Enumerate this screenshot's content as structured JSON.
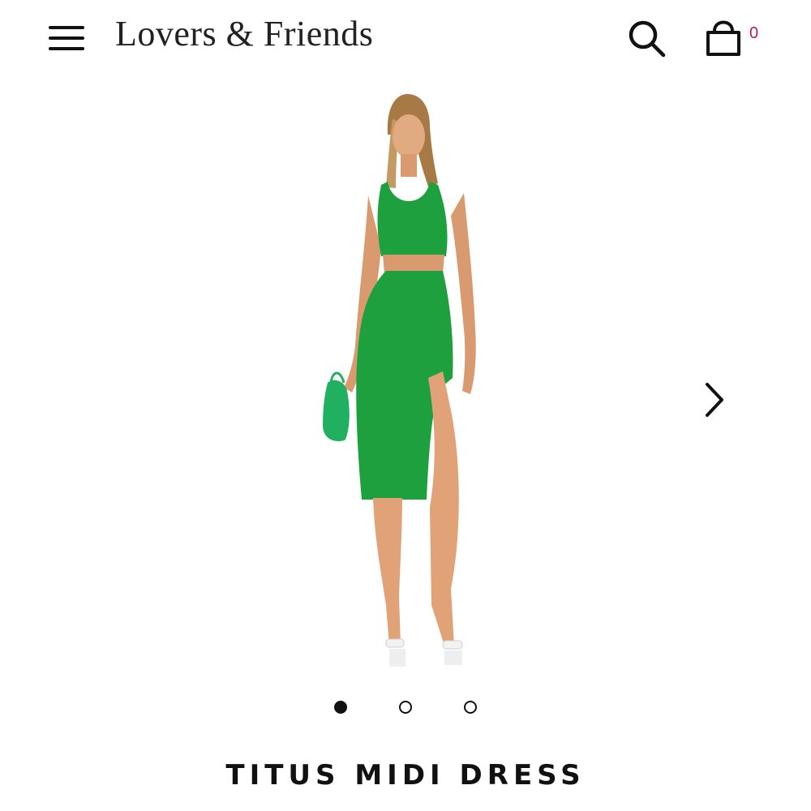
{
  "header": {
    "menu_icon": "hamburger-menu-icon",
    "brand": "Lovers & Friends",
    "search_icon": "search-icon",
    "bag_icon": "shopping-bag-icon",
    "cart_count": "0"
  },
  "gallery": {
    "image_count": 3,
    "active_index": 0,
    "next_icon": "chevron-right-icon",
    "dress_color": "#1fa03f"
  },
  "product": {
    "title": "TITUS MIDI DRESS"
  },
  "colors": {
    "accent": "#c2185b",
    "text": "#111111"
  }
}
